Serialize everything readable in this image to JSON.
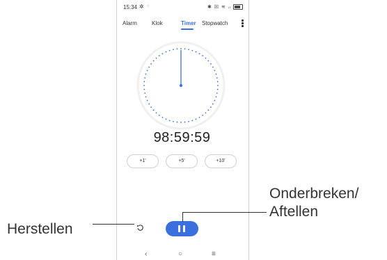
{
  "status_bar": {
    "time": "15:34",
    "gear_icon": "gear-icon",
    "right_icons": "✱ ☒ ≋ ᵢₗ"
  },
  "tabs": [
    {
      "label": "Alarm"
    },
    {
      "label": "Klok"
    },
    {
      "label": "Timer"
    },
    {
      "label": "Stopwatch"
    }
  ],
  "timer": {
    "readout": "98:59:59"
  },
  "quick_add": [
    {
      "label": "+1'"
    },
    {
      "label": "+5'"
    },
    {
      "label": "+10'"
    }
  ],
  "nav": {
    "back": "‹",
    "home": "○",
    "recents": "≡"
  },
  "callouts": {
    "pause_label_line1": "Onderbreken/",
    "pause_label_line2": "Aftellen",
    "reset_label": "Herstellen"
  },
  "colors": {
    "accent": "#3b6fe0"
  }
}
